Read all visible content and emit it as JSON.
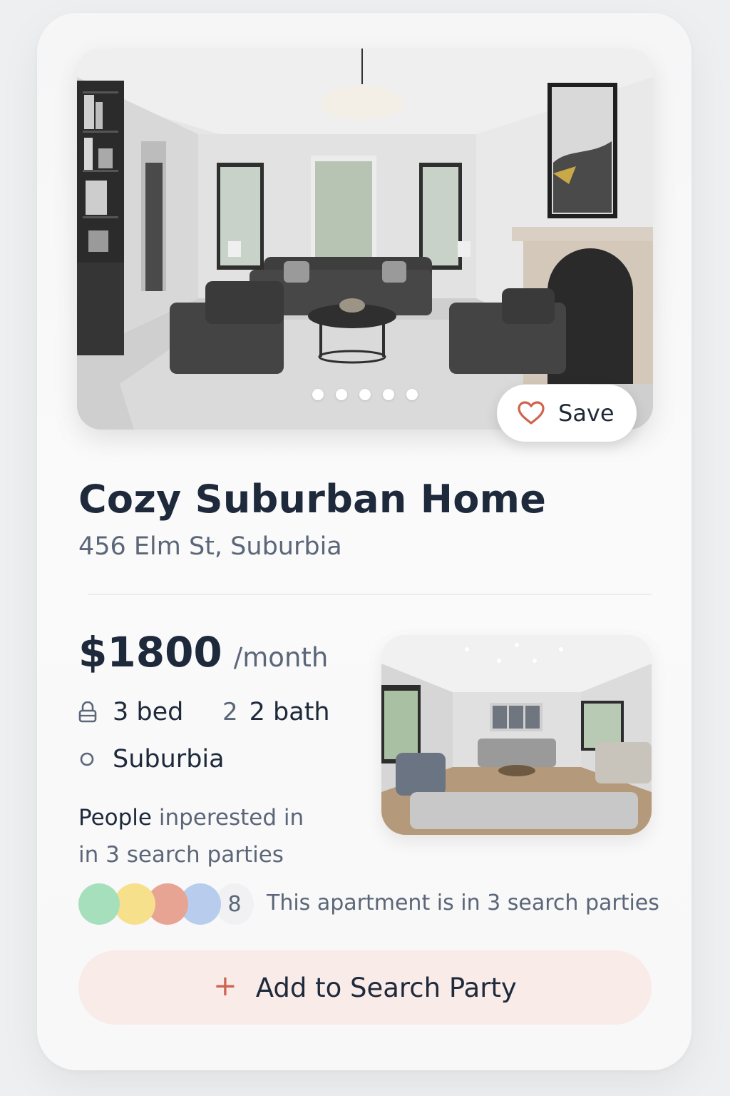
{
  "listing": {
    "title": "Cozy Suburban Home",
    "address": "456 Elm St, Suburbia",
    "price": "$1800",
    "price_unit": "/month",
    "beds_label": "3 bed",
    "bath_number": "2",
    "baths_label": "2 bath",
    "neighborhood": "Suburbia",
    "photo_dots": 5,
    "active_dot": 0
  },
  "hero": {
    "save_label": "Save",
    "save_icon": "heart-outline-icon"
  },
  "interest": {
    "line1_strong": "People",
    "line1_rest": " inperested in",
    "line2": "in 3 search parties"
  },
  "parties": {
    "avatar_colors": [
      "#a6dfbb",
      "#f7e08b",
      "#e8a493",
      "#b8cdee"
    ],
    "count": "8",
    "note": "This apartment is in 3 search parties"
  },
  "actions": {
    "add_plus": "+",
    "add_label": "Add to Search Party"
  },
  "colors": {
    "accent": "#d0634f",
    "accent_bg": "#f8ebe8",
    "title": "#1e2a3b",
    "muted": "#5b6678"
  }
}
